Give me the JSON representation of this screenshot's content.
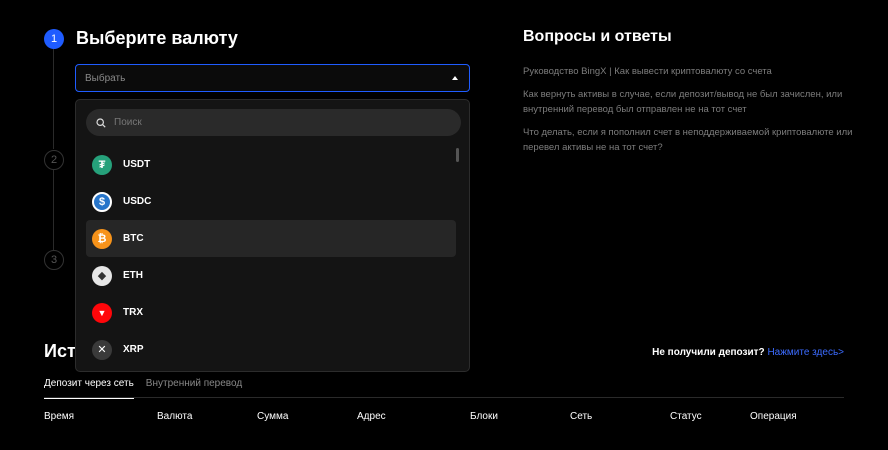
{
  "steps": {
    "active_number": "1",
    "step2_number": "2",
    "step3_number": "3",
    "title": "Выберите валюту"
  },
  "select": {
    "placeholder": "Выбрать"
  },
  "dropdown": {
    "search_placeholder": "Поиск",
    "items": [
      {
        "label": "USDT",
        "color": "#26a17b",
        "glyph": "₮"
      },
      {
        "label": "USDC",
        "color": "#2775ca",
        "glyph": "$"
      },
      {
        "label": "BTC",
        "color": "#f7931a",
        "glyph": "₿"
      },
      {
        "label": "ETH",
        "color": "#e6e6e6",
        "glyph": "◆"
      },
      {
        "label": "TRX",
        "color": "#ff060a",
        "glyph": "▼"
      },
      {
        "label": "XRP",
        "color": "#3a3a3a",
        "glyph": "✕"
      }
    ]
  },
  "faq": {
    "title": "Вопросы и ответы",
    "q1": "Руководство BingX | Как вывести криптовалюту со счета",
    "q2": "Как вернуть активы в случае, если депозит/вывод не был зачислен, или внутренний перевод был отправлен не на тот счет",
    "q3": "Что делать, если я пополнил счет в неподдерживаемой криптовалюте или перевел активы не на тот счет?"
  },
  "history": {
    "title": "История",
    "help_text": "Не получили депозит?",
    "help_link": "Нажмите здесь>",
    "tabs": [
      "Депозит через сеть",
      "Внутренний перевод"
    ],
    "columns": [
      "Время",
      "Валюта",
      "Сумма",
      "Адрес",
      "Блоки",
      "Сеть",
      "Статус",
      "Операция"
    ]
  },
  "colors": {
    "accent": "#1f5cff",
    "link": "#3b6bff"
  }
}
